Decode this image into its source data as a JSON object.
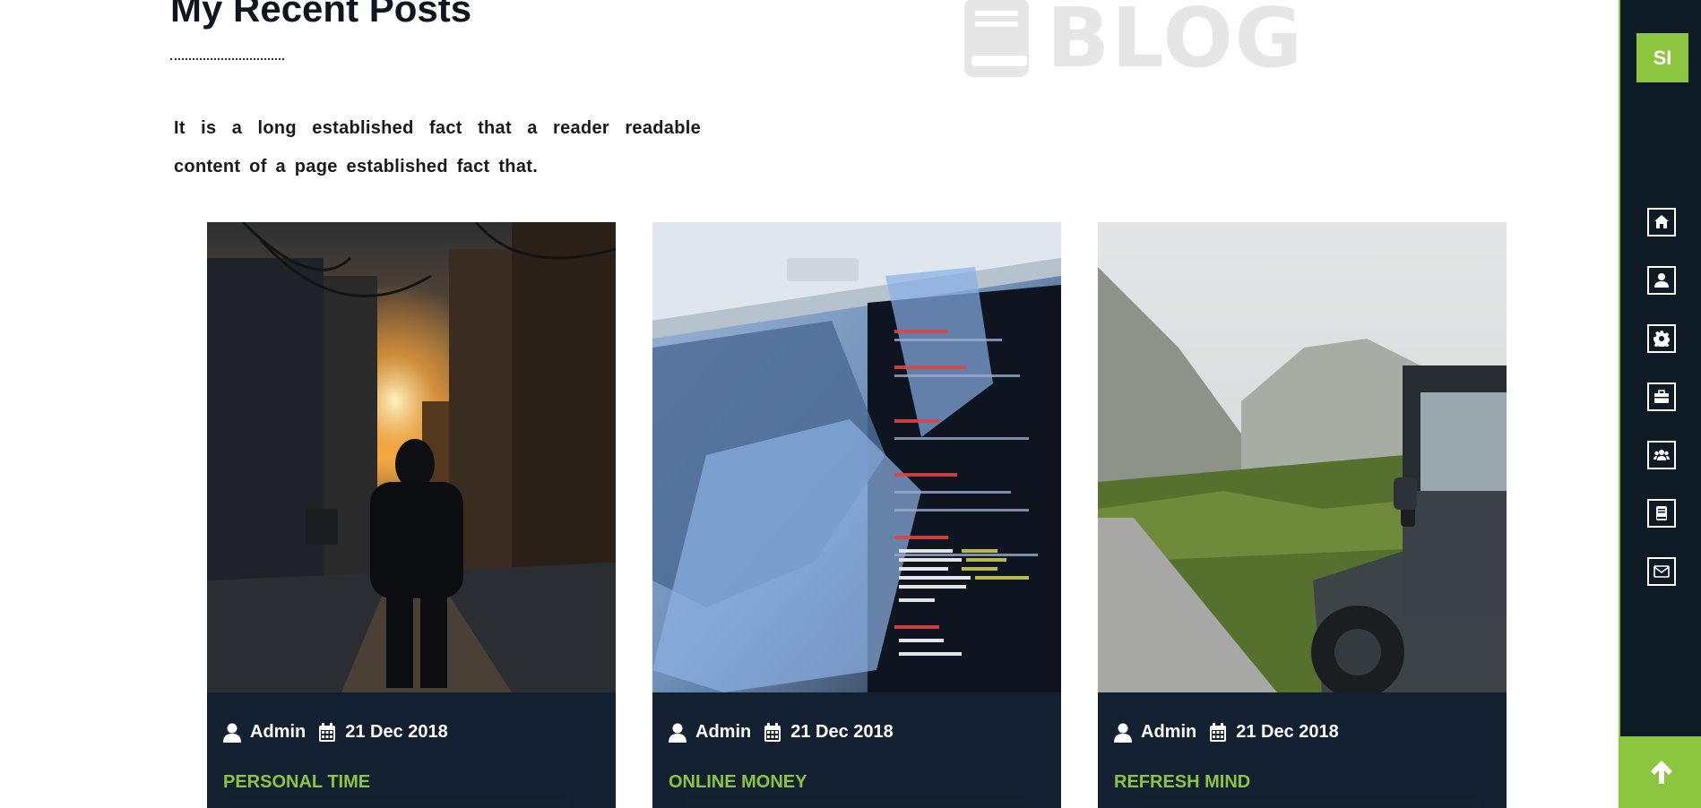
{
  "watermark": {
    "text": "BLOG",
    "icon": "book-icon"
  },
  "section": {
    "title": "My Recent Posts",
    "intro": "It is a long established fact that a reader readable content of a page established fact that."
  },
  "posts": [
    {
      "author": "Admin",
      "date": "21 Dec 2018",
      "category": "PERSONAL TIME",
      "image": "city-street-sunset-hooded-person"
    },
    {
      "author": "Admin",
      "date": "21 Dec 2018",
      "category": "ONLINE MONEY",
      "image": "code-on-laptop-screen"
    },
    {
      "author": "Admin",
      "date": "21 Dec 2018",
      "category": "REFRESH MIND",
      "image": "mountain-road-with-jeep"
    }
  ],
  "sidebar": {
    "logo": "SI",
    "nav": [
      {
        "icon": "home-icon"
      },
      {
        "icon": "user-icon"
      },
      {
        "icon": "gear-icon"
      },
      {
        "icon": "briefcase-icon"
      },
      {
        "icon": "users-icon"
      },
      {
        "icon": "book-icon"
      },
      {
        "icon": "envelope-icon"
      }
    ],
    "scroll_top_icon": "arrow-up-icon"
  },
  "colors": {
    "accent": "#8cc63f",
    "sidebar_bg": "#0f1a27",
    "card_bg": "#142131"
  }
}
